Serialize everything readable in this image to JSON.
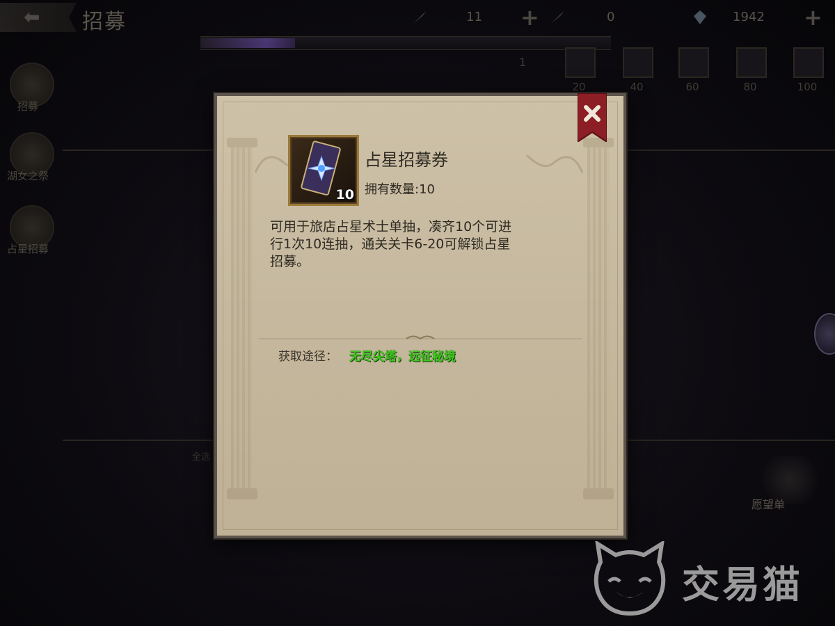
{
  "topbar": {
    "back_icon": "arrow-left-icon",
    "title": "招募",
    "resources": [
      {
        "icon": "quill-icon",
        "value": "11"
      },
      {
        "icon": "quill-icon",
        "value": "0"
      },
      {
        "icon": "crystal-icon",
        "value": "1942"
      }
    ]
  },
  "progress": {
    "left_count": "1",
    "fill_fraction": 0.23,
    "milestones": [
      "20",
      "40",
      "60",
      "80",
      "100"
    ]
  },
  "left_nav": {
    "items": [
      {
        "label": "招募",
        "icon": "recruit-icon"
      },
      {
        "label": "湖女之祭",
        "icon": "lake-lady-icon"
      },
      {
        "label": "占星招募",
        "icon": "astrology-icon"
      }
    ]
  },
  "background_labels": {
    "wishlist": "愿望单",
    "small_left": "全选"
  },
  "modal": {
    "item_name": "占星招募券",
    "item_count": "10",
    "owned_label": "拥有数量:10",
    "description": "可用于旅店占星术士单抽，凑齐10个可进行1次10连抽，通关关卡6-20可解锁占星招募。",
    "obtain_label": "获取途径：",
    "obtain_value": "无尽尖塔，远征秘境",
    "close_icon": "close-icon"
  },
  "watermark": {
    "text": "交易猫",
    "icon": "cat-logo-icon"
  },
  "colors": {
    "parchment": "#c7ba9f",
    "obtain_green": "#3ec61e",
    "ribbon_red": "#8c1e26"
  }
}
